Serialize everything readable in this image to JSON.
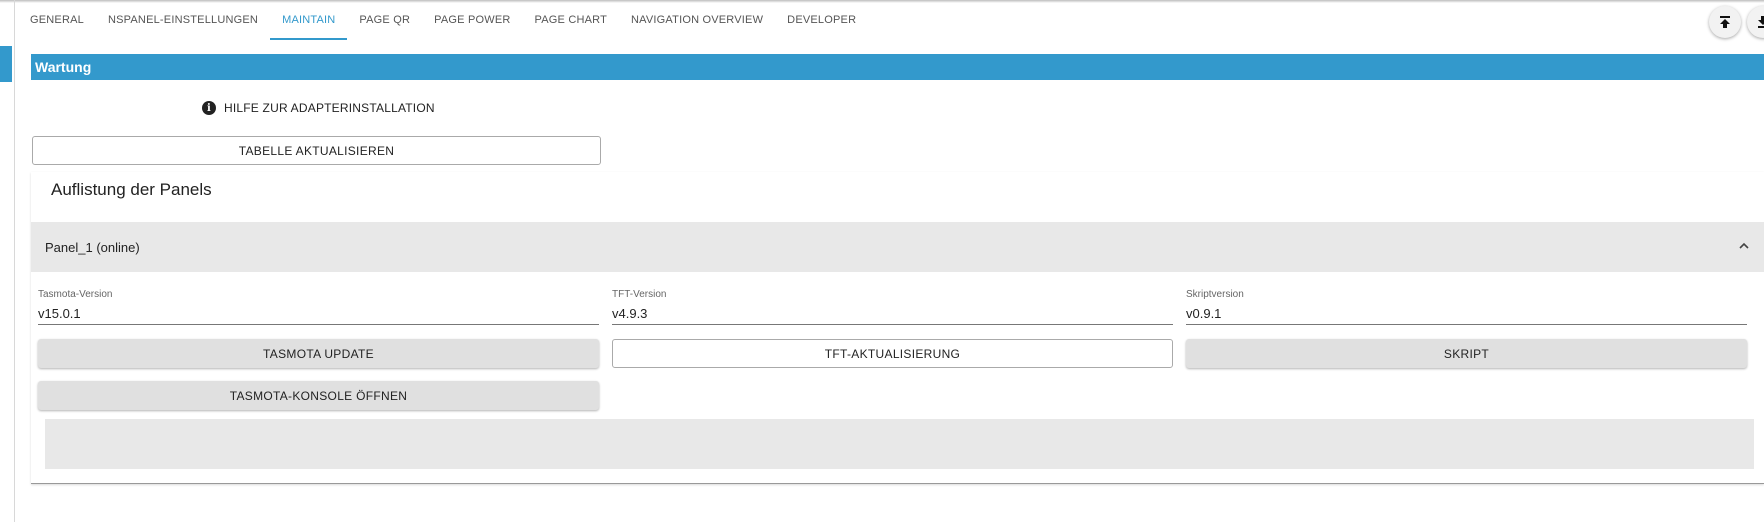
{
  "tabs": [
    {
      "label": "GENERAL"
    },
    {
      "label": "NSPANEL-EINSTELLUNGEN"
    },
    {
      "label": "MAINTAIN"
    },
    {
      "label": "PAGE QR"
    },
    {
      "label": "PAGE POWER"
    },
    {
      "label": "PAGE CHART"
    },
    {
      "label": "NAVIGATION OVERVIEW"
    },
    {
      "label": "DEVELOPER"
    }
  ],
  "active_tab": "MAINTAIN",
  "section": {
    "title": "Wartung"
  },
  "help": {
    "label": "HILFE ZUR ADAPTERINSTALLATION",
    "icon": "info-icon"
  },
  "refresh_button": {
    "label": "TABELLE AKTUALISIEREN"
  },
  "panels": {
    "title": "Auflistung der Panels",
    "items": [
      {
        "header": "Panel_1 (online)",
        "expanded": true,
        "tasmota": {
          "label": "Tasmota-Version",
          "value": "v15.0.1"
        },
        "tft": {
          "label": "TFT-Version",
          "value": "v4.9.3"
        },
        "script": {
          "label": "Skriptversion",
          "value": "v0.9.1"
        },
        "buttons": {
          "tasmota_update": "TASMOTA UPDATE",
          "tft_update": "TFT-AKTUALISIERUNG",
          "script": "SKRIPT",
          "tasmota_console": "TASMOTA-KONSOLE ÖFFNEN"
        }
      }
    ]
  },
  "toolbar": {
    "upload_icon": "upload-icon",
    "download_icon": "download-icon"
  },
  "colors": {
    "accent": "#3399cc",
    "accordion_bg": "#e8e8e8",
    "button_bg": "#e0e0e0"
  }
}
